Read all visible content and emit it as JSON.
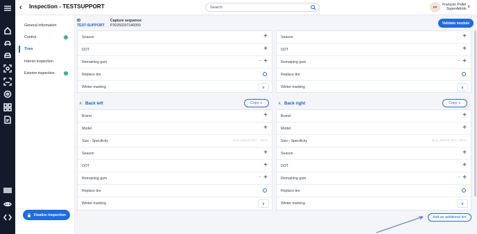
{
  "header": {
    "title": "Inspection - TESTSUPPORT",
    "search_placeholder": "Search",
    "avatar_initials": "FP",
    "user_name": "François Pollet",
    "user_role": "SuperAdmin"
  },
  "rail": {
    "icons": [
      "menu-icon",
      "home-icon",
      "car-icon",
      "car-front-icon",
      "camera-scan-icon",
      "scan-vehicle-icon",
      "target-icon",
      "grid-icon",
      "document-icon",
      "barcode-icon",
      "eye-icon",
      "code-icon"
    ]
  },
  "sidebar": {
    "items": [
      {
        "label": "General information",
        "done": false,
        "active": false
      },
      {
        "label": "Control",
        "done": true,
        "active": false
      },
      {
        "label": "Tires",
        "done": false,
        "active": true
      },
      {
        "label": "Interior inspection",
        "done": false,
        "active": false
      },
      {
        "label": "Exterior inspection",
        "done": true,
        "active": false
      }
    ],
    "finalize_label": "Finalize inspection"
  },
  "main": {
    "id_label": "ID",
    "id_value": "TEST-SUPPORT",
    "capture_label": "Capture sequence",
    "capture_value": "P20250207140059",
    "validate_label": "Validate module",
    "copy_label": "Copy",
    "add_tire_label": "Add an additional tire",
    "size_hint": "(e.g. 205/45 R17 - 94V)",
    "top_left_rows": [
      {
        "label": "Season",
        "control": "plus"
      },
      {
        "label": "DOT",
        "control": "plus"
      },
      {
        "label": "Remaining gum",
        "control": "stepper"
      },
      {
        "label": "Replace tire",
        "control": "radio"
      },
      {
        "label": "Winter marking",
        "control": "dropdown"
      }
    ],
    "top_right_rows": [
      {
        "label": "Season",
        "control": "plus"
      },
      {
        "label": "DOT",
        "control": "plus"
      },
      {
        "label": "Remaining gum",
        "control": "stepper"
      },
      {
        "label": "Replace tire",
        "control": "radio"
      },
      {
        "label": "Winter marking",
        "control": "dropdown"
      }
    ],
    "back_left": {
      "title": "Back left",
      "rows": [
        {
          "label": "Brand",
          "control": "plus"
        },
        {
          "label": "Model",
          "control": "plus"
        },
        {
          "label": "Size - Specificity",
          "control": "hint"
        },
        {
          "label": "Season",
          "control": "plus"
        },
        {
          "label": "DOT",
          "control": "plus"
        },
        {
          "label": "Remaining gum",
          "control": "stepper"
        },
        {
          "label": "Replace tire",
          "control": "radio"
        },
        {
          "label": "Winter marking",
          "control": "dropdown"
        }
      ]
    },
    "back_right": {
      "title": "Back right",
      "rows": [
        {
          "label": "Brand",
          "control": "plus"
        },
        {
          "label": "Model",
          "control": "plus"
        },
        {
          "label": "Size - Specificity",
          "control": "hint"
        },
        {
          "label": "Season",
          "control": "plus"
        },
        {
          "label": "DOT",
          "control": "plus"
        },
        {
          "label": "Remaining gum",
          "control": "stepper"
        },
        {
          "label": "Replace tire",
          "control": "radio"
        },
        {
          "label": "Winter marking",
          "control": "dropdown"
        }
      ]
    }
  },
  "colors": {
    "accent": "#1d6be6",
    "rail": "#121a2b",
    "done": "#27b49e"
  }
}
